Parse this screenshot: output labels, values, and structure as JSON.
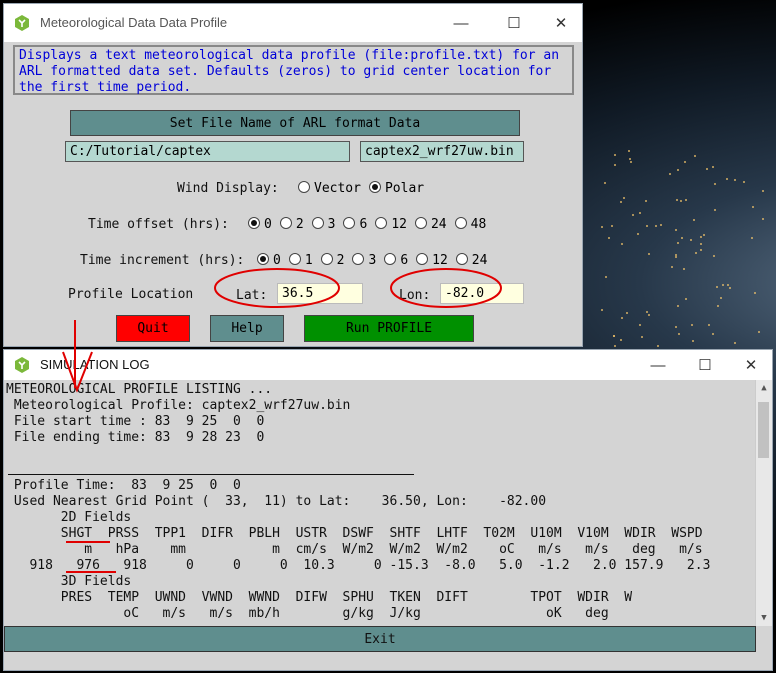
{
  "colors": {
    "description_text": "#0000d8",
    "set_file_button": "#5f8e8e",
    "field_bg": "#b4d8d0",
    "latlon_bg": "#ffffe0",
    "quit_button": "#ff0000",
    "help_button": "#5f8e8e",
    "run_button": "#009000",
    "annotation_red": "#e00000"
  },
  "main_window": {
    "title": "Meteorological Data Data Profile",
    "controls": {
      "minimize": "—",
      "maximize": "☐",
      "close": "✕"
    },
    "description": "Displays a text meteorological data profile (file:profile.txt) for an\nARL formatted data set. Defaults (zeros) to grid center location for\nthe first time period.",
    "set_file_button": "Set File Name of ARL format Data",
    "directory_value": "C:/Tutorial/captex",
    "filename_value": "captex2_wrf27uw.bin",
    "wind_display": {
      "label": "Wind Display:",
      "options": [
        "Vector",
        "Polar"
      ],
      "selected": "Polar"
    },
    "time_offset": {
      "label": "Time offset (hrs):",
      "options": [
        "0",
        "2",
        "3",
        "6",
        "12",
        "24",
        "48"
      ],
      "selected": "0"
    },
    "time_increment": {
      "label": "Time increment (hrs):",
      "options": [
        "0",
        "1",
        "2",
        "3",
        "6",
        "12",
        "24"
      ],
      "selected": "0"
    },
    "profile_location_label": "Profile Location",
    "lat_label": "Lat:",
    "lat_value": "36.5",
    "lon_label": "Lon:",
    "lon_value": "-82.0",
    "quit_button": "Quit",
    "help_button": "Help",
    "run_button": "Run PROFILE"
  },
  "log_window": {
    "title": "SIMULATION LOG",
    "controls": {
      "minimize": "—",
      "maximize": "☐",
      "close": "✕"
    },
    "lines": [
      "METEOROLOGICAL PROFILE LISTING ...",
      " Meteorological Profile: captex2_wrf27uw.bin",
      " File start time : 83  9 25  0  0",
      " File ending time: 83  9 28 23  0",
      "",
      "",
      " Profile Time:  83  9 25  0  0",
      " Used Nearest Grid Point (  33,  11) to Lat:    36.50, Lon:    -82.00",
      "       2D Fields",
      "       SHGT  PRSS  TPP1  DIFR  PBLH  USTR  DSWF  SHTF  LHTF  T02M  U10M  V10M  WDIR  WSPD",
      "          m   hPa    mm           m  cm/s  W/m2  W/m2  W/m2    oC   m/s   m/s   deg   m/s",
      "   918   976   918     0     0     0  10.3     0 -15.3  -8.0   5.0  -1.2   2.0 157.9   2.3",
      "       3D Fields",
      "       PRES  TEMP  UWND  VWND  WWND  DIFW  SPHU  TKEN  DIFT        TPOT  WDIR  W",
      "               oC   m/s   m/s  mb/h        g/kg  J/kg                oK   deg"
    ],
    "exit_button": "Exit"
  }
}
